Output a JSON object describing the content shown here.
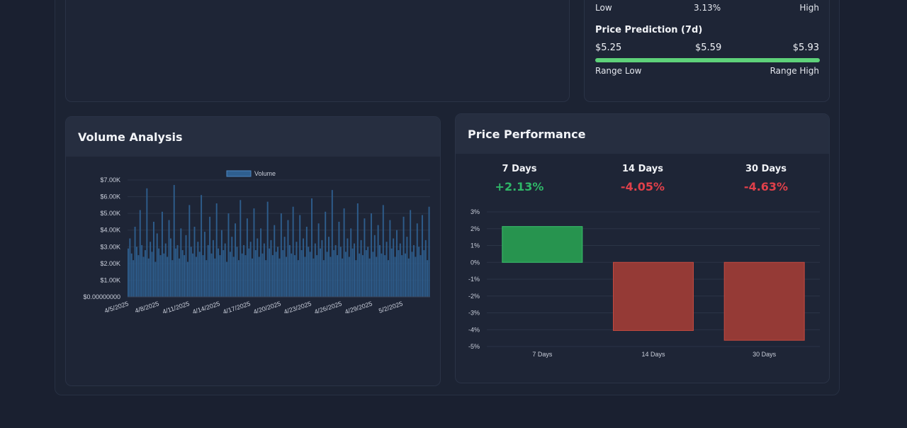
{
  "top_right_card": {
    "range_low_label": "Low",
    "range_mid_value": "3.13%",
    "range_high_label": "High",
    "prediction_title": "Price Prediction (7d)",
    "prediction_low": "$5.25",
    "prediction_mid": "$5.59",
    "prediction_high": "$5.93",
    "range_low_caption": "Range Low",
    "range_high_caption": "Range High",
    "bar_color": "#5ed27a"
  },
  "volume_card": {
    "title": "Volume Analysis"
  },
  "performance_card": {
    "title": "Price Performance",
    "periods": [
      {
        "label": "7 Days",
        "change": "+2.13%"
      },
      {
        "label": "14 Days",
        "change": "-4.05%"
      },
      {
        "label": "30 Days",
        "change": "-4.63%"
      }
    ]
  },
  "colors": {
    "positive": "#2fb768",
    "negative": "#e0404a",
    "volume_bar": "#2f5f8f"
  },
  "chart_data": [
    {
      "type": "bar",
      "legend": [
        "Volume"
      ],
      "legend_position": "top",
      "y_ticks": [
        "$0.00000000",
        "$1.00K",
        "$2.00K",
        "$3.00K",
        "$4.00K",
        "$5.00K",
        "$6.00K",
        "$7.00K"
      ],
      "ylim": [
        0,
        7000
      ],
      "x_ticks": [
        "4/5/2025",
        "4/8/2025",
        "4/11/2025",
        "4/14/2025",
        "4/17/2025",
        "4/20/2025",
        "4/23/2025",
        "4/26/2025",
        "4/29/2025",
        "5/2/2025"
      ],
      "series": [
        {
          "name": "Volume",
          "values": [
            2900,
            3500,
            2600,
            2200,
            4200,
            3000,
            2500,
            5200,
            3100,
            2400,
            2800,
            6500,
            2300,
            3300,
            2700,
            4500,
            2100,
            3800,
            2900,
            2500,
            5100,
            2600,
            3200,
            2400,
            4600,
            3500,
            2200,
            6700,
            2900,
            3100,
            2300,
            4100,
            2800,
            2500,
            3700,
            2100,
            5500,
            3000,
            2600,
            4200,
            2400,
            3300,
            2700,
            6100,
            2500,
            3900,
            2200,
            3100,
            4800,
            2600,
            3400,
            2300,
            5600,
            2900,
            2500,
            4000,
            2800,
            3200,
            2100,
            5000,
            2700,
            3600,
            2400,
            4400,
            3000,
            2200,
            5800,
            2600,
            3100,
            2500,
            4700,
            2900,
            3300,
            2300,
            5300,
            2800,
            3500,
            2400,
            4100,
            2600,
            3200,
            2200,
            5700,
            2900,
            3400,
            2500,
            4300,
            2700,
            3000,
            2300,
            5000,
            2800,
            3600,
            2400,
            4600,
            3100,
            2600,
            5400,
            2500,
            3300,
            2200,
            4900,
            2800,
            3500,
            2400,
            4200,
            3000,
            2700,
            5900,
            2300,
            3200,
            2500,
            4400,
            2900,
            3400,
            2200,
            5100,
            2700,
            3600,
            2400,
            6400,
            2800,
            3100,
            2500,
            4500,
            3000,
            2300,
            5300,
            2700,
            3500,
            2400,
            4100,
            2900,
            3200,
            2200,
            5600,
            2600,
            3400,
            2500,
            4700,
            2800,
            3000,
            2300,
            5000,
            2700,
            3700,
            2400,
            4300,
            3100,
            2600,
            5500,
            2500,
            3300,
            2200,
            4600,
            2900,
            3500,
            2400,
            4000,
            2800,
            3200,
            2500,
            4800,
            2600,
            3600,
            2300,
            5200,
            2700,
            3100,
            2400,
            4400,
            3000,
            2500,
            4900,
            2800,
            3400,
            2200,
            5400
          ]
        }
      ]
    },
    {
      "type": "bar",
      "categories": [
        "7 Days",
        "14 Days",
        "30 Days"
      ],
      "values": [
        2.13,
        -4.05,
        -4.63
      ],
      "unit": "%",
      "y_ticks": [
        "3%",
        "2%",
        "1%",
        "0%",
        "-1%",
        "-2%",
        "-3%",
        "-4%",
        "-5%"
      ],
      "ylim": [
        -5,
        3
      ]
    }
  ]
}
